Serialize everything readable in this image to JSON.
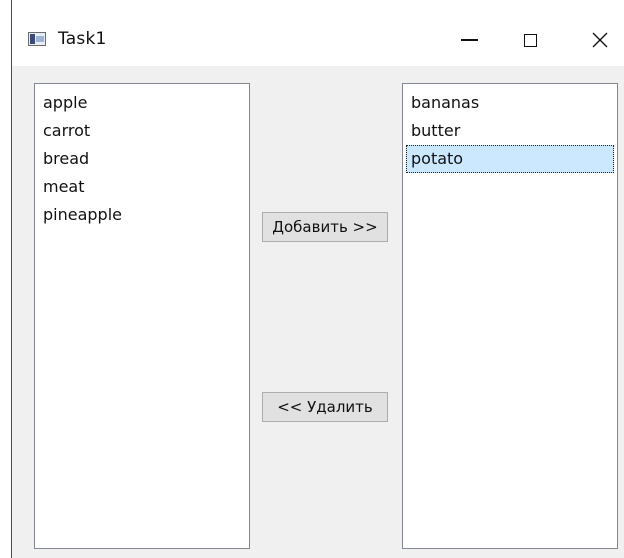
{
  "window": {
    "title": "Task1"
  },
  "left_list": {
    "items": [
      "apple",
      "carrot",
      "bread",
      "meat",
      "pineapple"
    ]
  },
  "right_list": {
    "items": [
      "bananas",
      "butter",
      "potato"
    ],
    "selected_index": 2
  },
  "buttons": {
    "add_label": "Добавить >>",
    "remove_label": "<< Удалить"
  },
  "colors": {
    "selection_bg": "#cce8ff",
    "button_bg": "#e1e1e1",
    "window_bg": "#f0f0f0"
  },
  "icons": {
    "app": "app-window-icon",
    "minimize": "minimize-icon",
    "maximize": "maximize-icon",
    "close": "close-icon"
  }
}
